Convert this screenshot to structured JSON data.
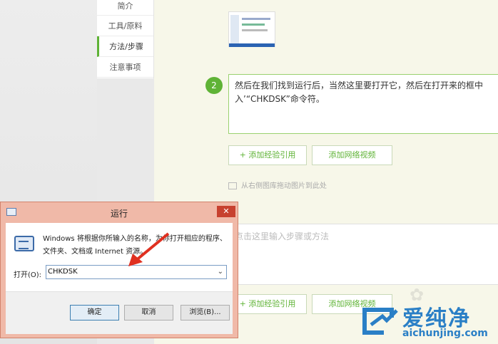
{
  "sidebar": {
    "items": [
      {
        "label": "简介"
      },
      {
        "label": "工具/原料"
      },
      {
        "label": "方法/步骤"
      },
      {
        "label": "注意事项"
      }
    ]
  },
  "main": {
    "step_number": "2",
    "step_text": "然后在我们找到运行后，当然这里要打开它，然后在打开来的框中\n入’“CHKDSK”命令符。",
    "add_experience_label": "+ 添加经验引用",
    "add_video_label": "添加网络视频",
    "drag_hint": "从右侧图库拖动图片到此处",
    "step_placeholder": "点击这里输入步骤或方法",
    "add_experience_label_2": "+ 添加经验引用",
    "add_video_label_2": "添加网络视频"
  },
  "dialog": {
    "title": "运行",
    "close": "✕",
    "description": "Windows 将根据你所输入的名称，为你打开相应的程序、\n文件夹、文档或 Internet 资源。",
    "open_label": "打开(O):",
    "open_value": "CHKDSK",
    "ok_label": "确定",
    "cancel_label": "取消",
    "browse_label": "浏览(B)..."
  },
  "watermark": {
    "brand_cn": "爱纯净",
    "brand_en": "aichunjing.com"
  },
  "colors": {
    "accent_green": "#5fb336",
    "dialog_frame": "#f0b9a8",
    "close_red": "#c7412f",
    "arrow_red": "#e03020",
    "watermark_blue": "#2a7fc6"
  }
}
